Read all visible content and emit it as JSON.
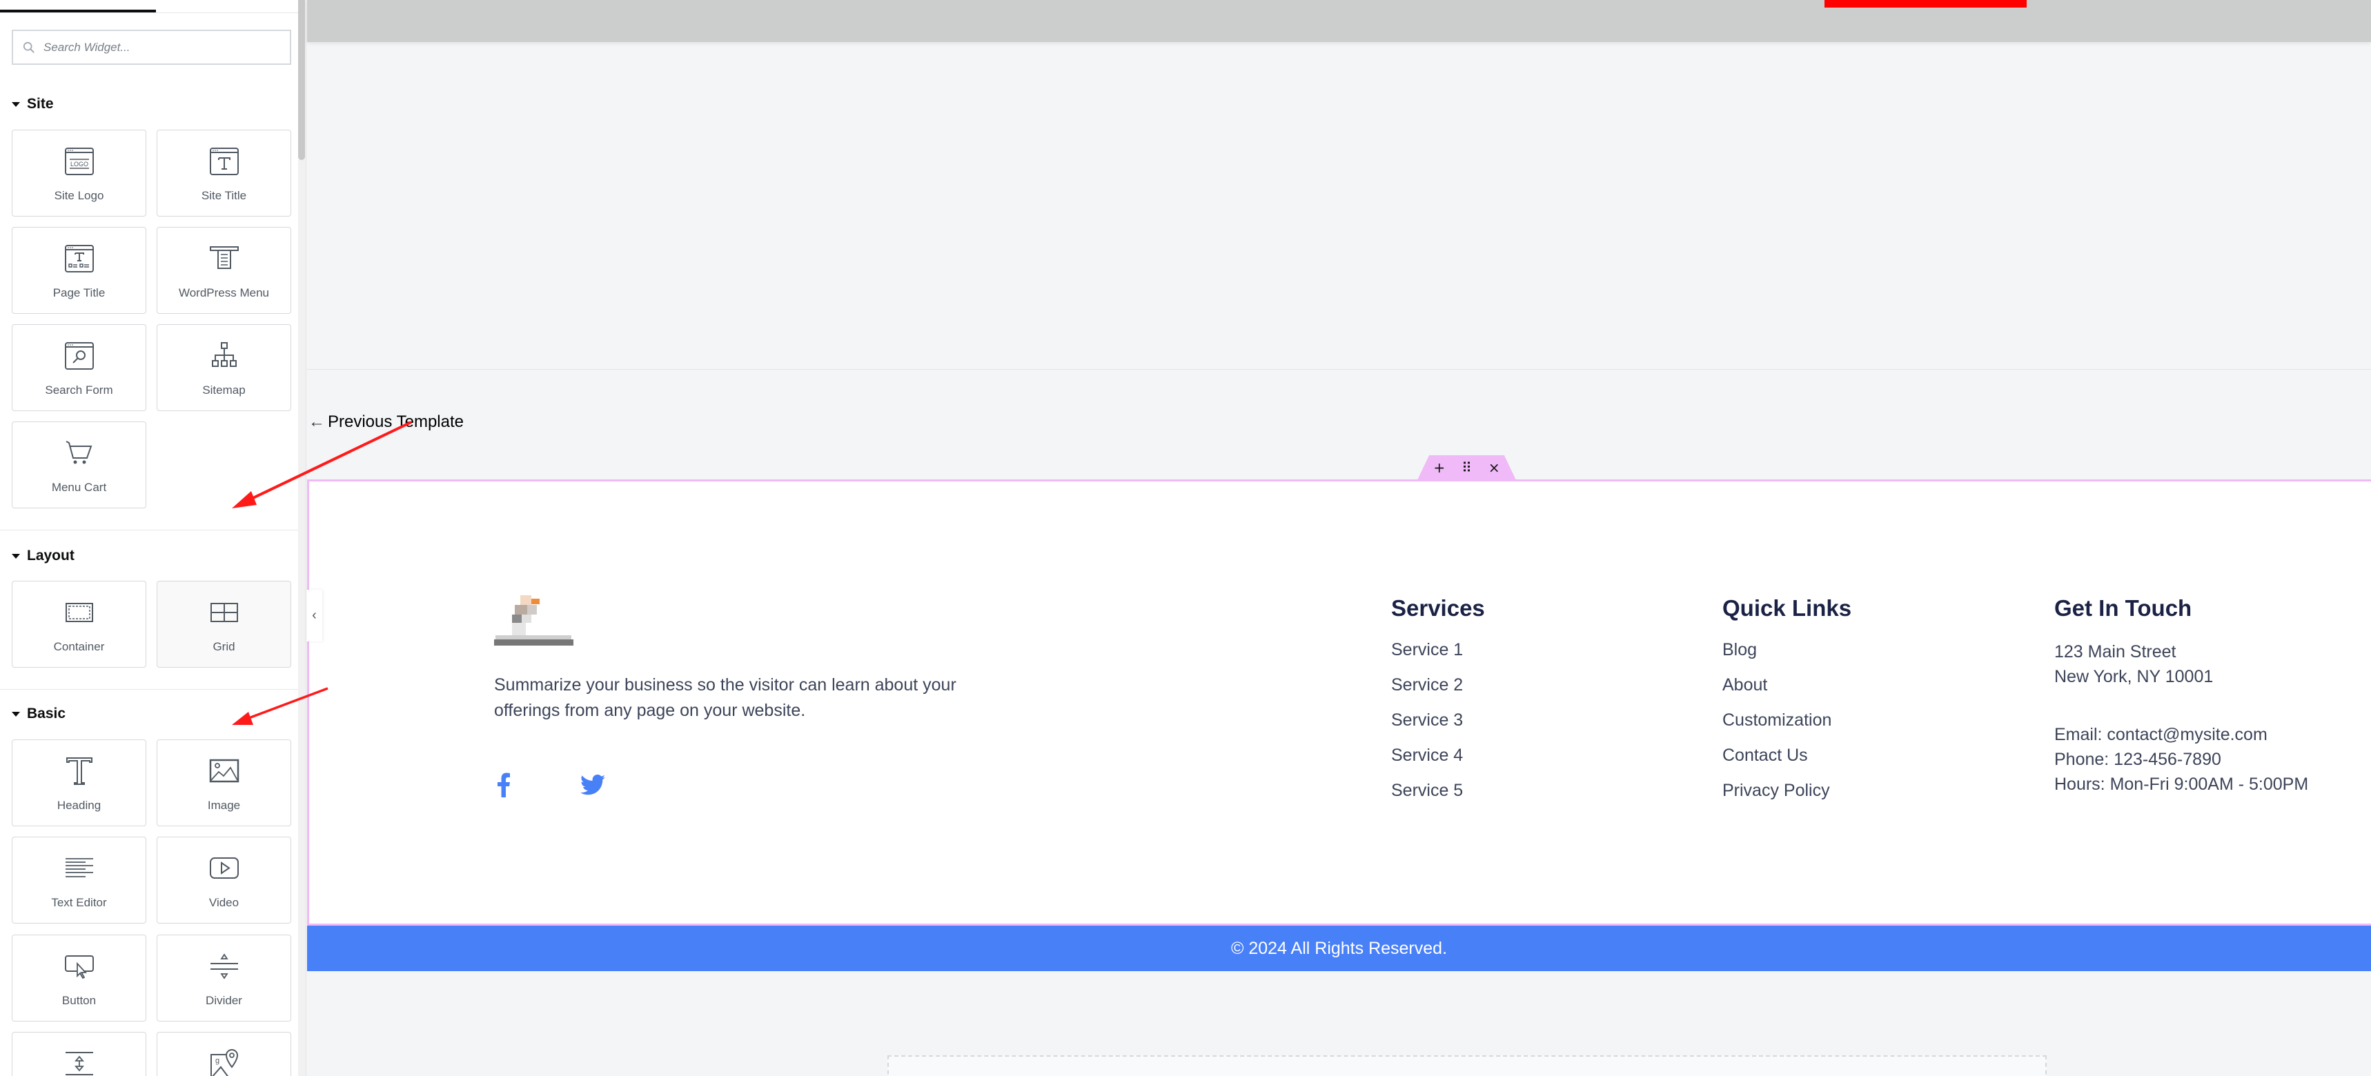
{
  "sidebar": {
    "search": {
      "placeholder": "Search Widget..."
    },
    "sections": [
      {
        "title": "Site",
        "widgets": [
          {
            "label": "Site Logo",
            "icon": "site-logo-icon"
          },
          {
            "label": "Site Title",
            "icon": "site-title-icon"
          },
          {
            "label": "Page Title",
            "icon": "page-title-icon"
          },
          {
            "label": "WordPress Menu",
            "icon": "wordpress-menu-icon"
          },
          {
            "label": "Search Form",
            "icon": "search-form-icon"
          },
          {
            "label": "Sitemap",
            "icon": "sitemap-icon"
          },
          {
            "label": "Menu Cart",
            "icon": "cart-icon"
          }
        ]
      },
      {
        "title": "Layout",
        "widgets": [
          {
            "label": "Container",
            "icon": "container-icon"
          },
          {
            "label": "Grid",
            "icon": "grid-icon"
          }
        ]
      },
      {
        "title": "Basic",
        "widgets": [
          {
            "label": "Heading",
            "icon": "heading-icon"
          },
          {
            "label": "Image",
            "icon": "image-icon"
          },
          {
            "label": "Text Editor",
            "icon": "text-editor-icon"
          },
          {
            "label": "Video",
            "icon": "video-icon"
          },
          {
            "label": "Button",
            "icon": "button-icon"
          },
          {
            "label": "Divider",
            "icon": "divider-icon"
          },
          {
            "label": "",
            "icon": "spacer-icon"
          },
          {
            "label": "",
            "icon": "google-maps-icon"
          }
        ]
      }
    ],
    "collapse_icon": "chevron-left-icon"
  },
  "canvas": {
    "previous_template": {
      "arrow": "←",
      "label": "Previous Template"
    },
    "section_handle": {
      "add": "+",
      "drag": "⠿",
      "delete": "×"
    },
    "footer": {
      "about": "Summarize your business so the visitor can learn about your offerings from any page on your website.",
      "social": [
        {
          "name": "facebook-icon"
        },
        {
          "name": "twitter-icon"
        }
      ],
      "services": {
        "title": "Services",
        "items": [
          "Service 1",
          "Service 2",
          "Service 3",
          "Service 4",
          "Service 5"
        ]
      },
      "quick_links": {
        "title": "Quick Links",
        "items": [
          "Blog",
          "About",
          "Customization",
          "Contact Us",
          "Privacy Policy"
        ]
      },
      "contact": {
        "title": "Get In Touch",
        "address": [
          "123 Main Street",
          "New York, NY 10001"
        ],
        "details": [
          "Email: contact@mysite.com",
          "Phone: 123-456-7890",
          "Hours: Mon-Fri 9:00AM - 5:00PM"
        ]
      },
      "copyright": "© 2024 All Rights Reserved."
    }
  },
  "colors": {
    "accent_blue": "#4880f8",
    "heading_navy": "#1b2245",
    "section_outline": "#f0b9f7",
    "annotation_red": "#ff0000"
  }
}
